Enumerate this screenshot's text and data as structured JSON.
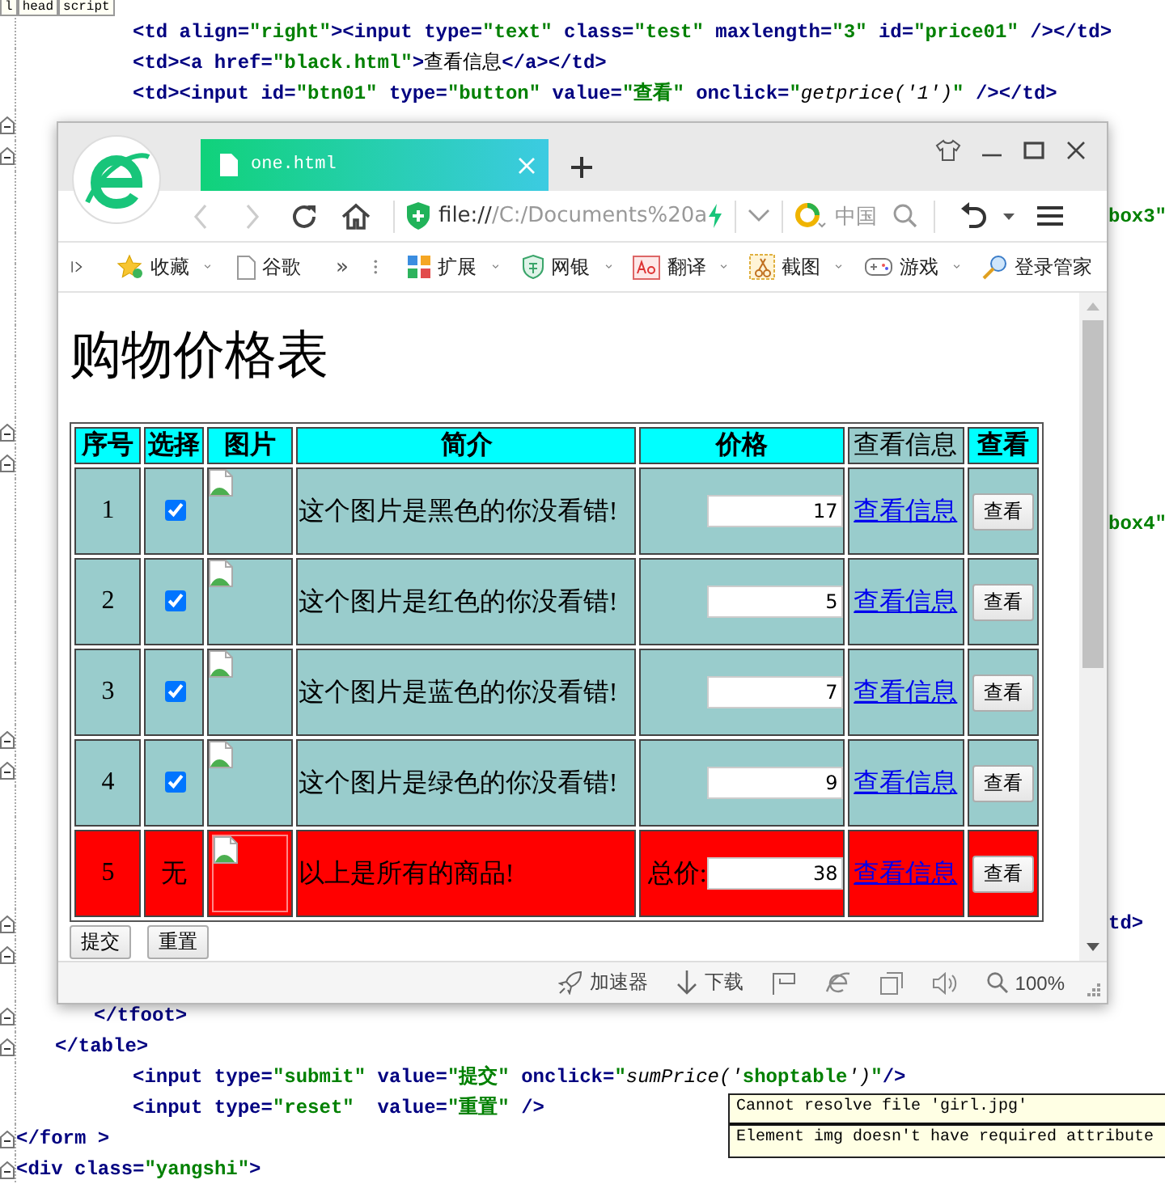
{
  "editor": {
    "breadcrumb": [
      "l",
      "head",
      "script"
    ],
    "lines": [
      {
        "fold": false,
        "tokens": [
          {
            "t": "\t\t\t<td",
            "kind": "tag"
          },
          {
            "t": " align=",
            "kind": "attr"
          },
          {
            "t": "\"right\"",
            "kind": "val"
          },
          {
            "t": "><input",
            "kind": "tag"
          },
          {
            "t": " type=",
            "kind": "attr"
          },
          {
            "t": "\"text\"",
            "kind": "val"
          },
          {
            "t": " class=",
            "kind": "attr"
          },
          {
            "t": "\"test\"",
            "kind": "val"
          },
          {
            "t": " maxlength=",
            "kind": "attr"
          },
          {
            "t": "\"3\"",
            "kind": "val"
          },
          {
            "t": " id=",
            "kind": "attr"
          },
          {
            "t": "\"price01\"",
            "kind": "val"
          },
          {
            "t": " /></td>",
            "kind": "tag"
          }
        ]
      },
      {
        "fold": false,
        "tokens": [
          {
            "t": "\t\t\t<td><a",
            "kind": "tag"
          },
          {
            "t": " href=",
            "kind": "attr"
          },
          {
            "t": "\"black.html\"",
            "kind": "val"
          },
          {
            "t": ">",
            "kind": "tag"
          },
          {
            "t": "查看信息",
            "kind": "text"
          },
          {
            "t": "</a></td>",
            "kind": "tag"
          }
        ]
      },
      {
        "fold": false,
        "tokens": [
          {
            "t": "\t\t\t<td><input",
            "kind": "tag"
          },
          {
            "t": " id=",
            "kind": "attr"
          },
          {
            "t": "\"btn01\"",
            "kind": "val"
          },
          {
            "t": " type=",
            "kind": "attr"
          },
          {
            "t": "\"button\"",
            "kind": "val"
          },
          {
            "t": " value=",
            "kind": "attr"
          },
          {
            "t": "\"查看\"",
            "kind": "val"
          },
          {
            "t": " onclick=",
            "kind": "attr"
          },
          {
            "t": "\"",
            "kind": "val"
          },
          {
            "t": "getprice('1')",
            "kind": "fn"
          },
          {
            "t": "\"",
            "kind": "val"
          },
          {
            "t": " /></td>",
            "kind": "tag"
          }
        ]
      },
      {
        "fold": true
      },
      {
        "fold": true
      },
      {
        "fold": false
      },
      {
        "fold": false,
        "fragment": true,
        "tokens": [
          {
            "t": "box3\"",
            "kind": "val"
          }
        ]
      },
      {
        "fold": false
      },
      {
        "fold": false
      },
      {
        "fold": false
      },
      {
        "fold": false
      },
      {
        "fold": false
      },
      {
        "fold": false
      },
      {
        "fold": true
      },
      {
        "fold": true
      },
      {
        "fold": false
      },
      {
        "fold": false,
        "fragment": true,
        "tokens": [
          {
            "t": "box4\"",
            "kind": "val"
          }
        ]
      },
      {
        "fold": false
      },
      {
        "fold": false
      },
      {
        "fold": false
      },
      {
        "fold": false
      },
      {
        "fold": false
      },
      {
        "fold": false
      },
      {
        "fold": true
      },
      {
        "fold": true
      },
      {
        "fold": false
      },
      {
        "fold": false
      },
      {
        "fold": false
      },
      {
        "fold": false
      },
      {
        "fold": true,
        "fragment": true,
        "tokens": [
          {
            "t": "td>",
            "kind": "tag"
          }
        ]
      },
      {
        "fold": true
      },
      {
        "fold": false
      },
      {
        "fold": true,
        "tokens": [
          {
            "t": "\t\t</tfoot>",
            "kind": "tag"
          }
        ]
      },
      {
        "fold": true,
        "tokens": [
          {
            "t": "\t</table>",
            "kind": "tag"
          }
        ]
      },
      {
        "fold": false,
        "tokens": [
          {
            "t": "\t\t\t<input",
            "kind": "tag"
          },
          {
            "t": " type=",
            "kind": "attr"
          },
          {
            "t": "\"submit\"",
            "kind": "val"
          },
          {
            "t": " value=",
            "kind": "attr"
          },
          {
            "t": "\"提交\"",
            "kind": "val"
          },
          {
            "t": " onclick=",
            "kind": "attr"
          },
          {
            "t": "\"",
            "kind": "val"
          },
          {
            "t": "sumPrice('",
            "kind": "fn"
          },
          {
            "t": "shoptable",
            "kind": "val"
          },
          {
            "t": "')",
            "kind": "fn"
          },
          {
            "t": "\"",
            "kind": "val"
          },
          {
            "t": "/>",
            "kind": "tag"
          }
        ]
      },
      {
        "fold": false,
        "tokens": [
          {
            "t": "\t\t\t<input",
            "kind": "tag"
          },
          {
            "t": " type=",
            "kind": "attr"
          },
          {
            "t": "\"reset\"",
            "kind": "val"
          },
          {
            "t": "  value=",
            "kind": "attr"
          },
          {
            "t": "\"重置\"",
            "kind": "val"
          },
          {
            "t": " />",
            "kind": "tag"
          }
        ]
      },
      {
        "fold": true,
        "tokens": [
          {
            "t": "</form >",
            "kind": "tag"
          }
        ]
      },
      {
        "fold": true,
        "tokens": [
          {
            "t": "<div",
            "kind": "tag"
          },
          {
            "t": " class=",
            "kind": "attr"
          },
          {
            "t": "\"yangshi\"",
            "kind": "val"
          },
          {
            "t": ">",
            "kind": "tag"
          }
        ]
      }
    ]
  },
  "browser": {
    "tab": {
      "title": "one.html",
      "selected": true
    },
    "address": {
      "scheme": "file://",
      "path": "/C:/Documents%20a"
    },
    "search": {
      "placeholder": "中国"
    },
    "bookmarks": [
      {
        "label": "收藏",
        "menu": true
      },
      {
        "label": "谷歌",
        "menu": false
      }
    ],
    "more": "»",
    "tools": [
      {
        "label": "扩展",
        "menu": true
      },
      {
        "label": "网银",
        "menu": true
      },
      {
        "label": "翻译",
        "menu": true
      },
      {
        "label": "截图",
        "menu": true
      },
      {
        "label": "游戏",
        "menu": true
      },
      {
        "label": "登录管家",
        "menu": false
      }
    ],
    "page": {
      "heading": "购物价格表",
      "columns": [
        {
          "label": "序号",
          "emphasized": true
        },
        {
          "label": "选择",
          "emphasized": true
        },
        {
          "label": "图片",
          "emphasized": true
        },
        {
          "label": "简介",
          "emphasized": true
        },
        {
          "label": "价格",
          "emphasized": true
        },
        {
          "label": "查看信息",
          "emphasized": false
        },
        {
          "label": "查看",
          "emphasized": true
        }
      ],
      "rows": [
        {
          "kind": "item",
          "number": "1",
          "checked": true,
          "description": "这个图片是黑色的你没看错!",
          "price": "17",
          "link": "查看信息",
          "button": "查看"
        },
        {
          "kind": "item",
          "number": "2",
          "checked": true,
          "description": "这个图片是红色的你没看错!",
          "price": "5",
          "link": "查看信息",
          "button": "查看"
        },
        {
          "kind": "item",
          "number": "3",
          "checked": true,
          "description": "这个图片是蓝色的你没看错!",
          "price": "7",
          "link": "查看信息",
          "button": "查看"
        },
        {
          "kind": "item",
          "number": "4",
          "checked": true,
          "description": "这个图片是绿色的你没看错!",
          "price": "9",
          "link": "查看信息",
          "button": "查看"
        },
        {
          "kind": "total",
          "number": "5",
          "choice": "无",
          "description": "以上是所有的商品!",
          "price_label": "总价:",
          "price": "38",
          "link": "查看信息",
          "button": "查看"
        }
      ],
      "buttons": [
        "提交",
        "重置"
      ]
    },
    "status": {
      "items": [
        "加速器",
        "下载"
      ],
      "zoom": "100%"
    }
  },
  "tooltip": {
    "lines": [
      "Cannot resolve file 'girl.jpg'",
      "Element img doesn't have required attribute"
    ]
  }
}
